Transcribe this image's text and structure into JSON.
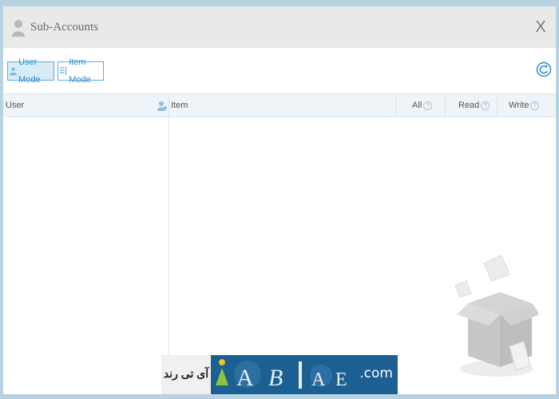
{
  "window": {
    "title": "Sub-Accounts",
    "close_label": "X",
    "icons": {
      "title": "user-icon",
      "close": "close-icon",
      "refresh": "refresh-icon"
    }
  },
  "toolbar": {
    "user_mode_label": "User Mode",
    "item_mode_label": "Item Mode",
    "active_mode": "User Mode"
  },
  "table": {
    "columns": {
      "user": "User",
      "item": "Item",
      "all": "All",
      "read": "Read",
      "write": "Write"
    },
    "help_glyph": "?",
    "rows": []
  },
  "watermark": {
    "text_left": "آی تی رند",
    "text_right": ".com"
  },
  "colors": {
    "accent": "#2a8fd0",
    "titlebar": "#e9e9e9",
    "header_bg": "#eef4f8",
    "outer_bg": "#b7d2e0"
  }
}
